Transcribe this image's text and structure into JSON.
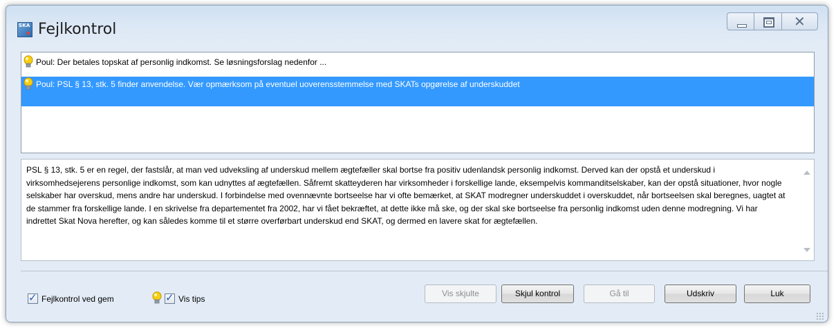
{
  "window": {
    "title": "Fejlkontrol",
    "icon_label": "SKA"
  },
  "messages": [
    {
      "icon": "lightbulb-icon",
      "text": "Poul: Der betales topskat af personlig indkomst. Se løsningsforslag nedenfor ...",
      "selected": false
    },
    {
      "icon": "lightbulb-icon",
      "text": "Poul: PSL § 13, stk. 5 finder anvendelse. Vær opmærksom på eventuel uoverensstemmelse med SKATs opgørelse af underskuddet",
      "selected": true
    }
  ],
  "detail": {
    "text": "PSL § 13, stk. 5 er en regel, der fastslår, at man ved udveksling af underskud mellem ægtefæller skal bortse fra positiv udenlandsk personlig indkomst. Derved kan der opstå et underskud i virksomhedsejerens personlige indkomst, som kan udnyttes af ægtefællen. Såfremt skatteyderen har virksomheder i forskellige lande, eksempelvis kommanditselskaber, kan der opstå situationer, hvor nogle selskaber har overskud, mens andre har underskud. I forbindelse med ovennævnte bortseelse har vi ofte bemærket, at SKAT modregner underskuddet i overskuddet, når bortseelsen skal beregnes, uagtet at de stammer fra forskellige lande. I en skrivelse fra departementet fra 2002, har vi fået bekræftet, at dette ikke må ske, og der skal ske bortseelse fra personlig indkomst uden denne modregning. Vi har indrettet Skat Nova herefter, og kan således komme til et større overførbart underskud end SKAT, og dermed en lavere skat for ægtefællen."
  },
  "footer": {
    "check_save_label": "Fejlkontrol ved gem",
    "check_save_checked": true,
    "check_tips_label": "Vis tips",
    "check_tips_checked": true,
    "buttons": {
      "show_hidden": "Vis skjulte",
      "hide_control": "Skjul kontrol",
      "goto": "Gå til",
      "print": "Udskriv",
      "close": "Luk"
    }
  },
  "colors": {
    "selection": "#3399ff",
    "bulb": "#f5c400"
  }
}
